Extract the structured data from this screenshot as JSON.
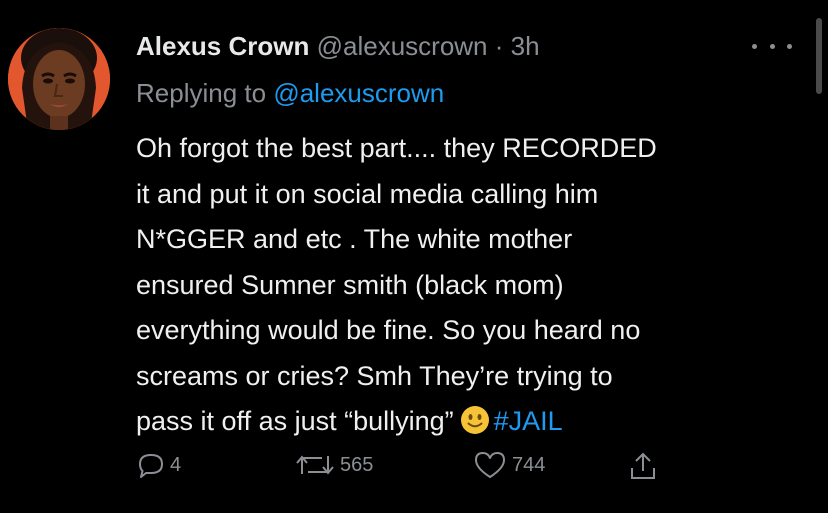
{
  "tweet": {
    "author_name": "Alexus Crown",
    "author_handle": "@alexuscrown",
    "separator": "·",
    "time": "3h",
    "reply_prefix": "Replying to",
    "reply_to": "@alexuscrown",
    "lines": [
      "Oh forgot the best part.... they RECORDED",
      "it and put it on social media calling him",
      "N*GGER and etc . The white mother",
      "ensured Sumner smith (black mom)",
      "everything would be fine. So you heard no",
      "screams or cries? Smh They’re trying to",
      "pass it off as just “bullying”"
    ],
    "emoji": "slightly-smiling-face",
    "hashtag": "#JAIL"
  },
  "actions": {
    "replies": "4",
    "retweets": "565",
    "likes": "744"
  },
  "icons": {
    "reply": "speech-bubble-icon",
    "retweet": "retweet-arrows-icon",
    "like": "heart-outline-icon",
    "share": "share-upload-icon",
    "more": "more-dots-icon"
  },
  "colors": {
    "background": "#000000",
    "text": "#e7e9ea",
    "secondary": "#8b8f94",
    "link": "#1d9bf0",
    "avatar_bg": "#e2572e"
  }
}
